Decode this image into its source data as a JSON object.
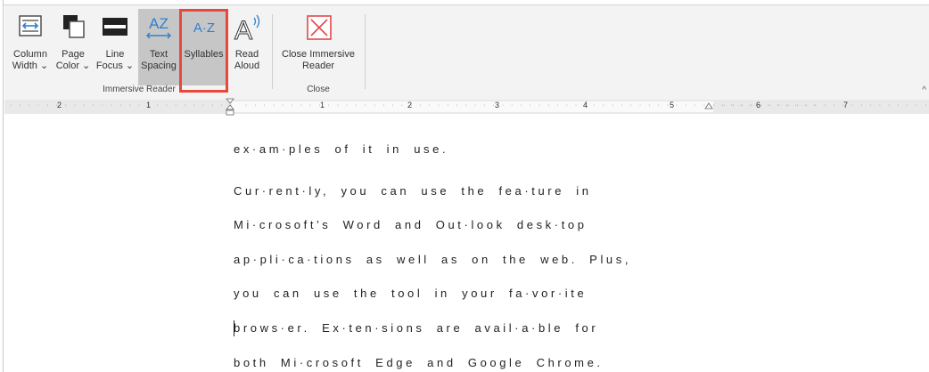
{
  "ribbon": {
    "buttons": [
      {
        "id": "column-width",
        "line1": "Column",
        "line2": "Width ⌄"
      },
      {
        "id": "page-color",
        "line1": "Page",
        "line2": "Color ⌄"
      },
      {
        "id": "line-focus",
        "line1": "Line",
        "line2": "Focus ⌄"
      },
      {
        "id": "text-spacing",
        "line1": "Text",
        "line2": "Spacing"
      },
      {
        "id": "syllables",
        "line1": "Syllables",
        "line2": ""
      },
      {
        "id": "read-aloud",
        "line1": "Read",
        "line2": "Aloud"
      },
      {
        "id": "close-immersive",
        "line1": "Close Immersive",
        "line2": "Reader"
      }
    ],
    "icon_text": {
      "text_spacing": "AZ",
      "syllables": "A·Z",
      "read_aloud": "A"
    },
    "groups": {
      "immersive_reader": "Immersive Reader",
      "close": "Close"
    },
    "collapse_glyph": "^"
  },
  "ruler": {
    "numbers": [
      "2",
      "1",
      "1",
      "2",
      "3",
      "4",
      "5",
      "6",
      "7"
    ]
  },
  "document": {
    "lines": [
      "ex·am·ples of it in use.",
      "Cur·rent·ly, you can use the fea·ture in",
      "Mi·crosoft’s Word and Out·look desk·top",
      "ap·pli·ca·tions as well as on the web. Plus,",
      "you can use the tool in your fa·vor·ite",
      "brows·er. Ex·ten·sions are avail·a·ble for",
      "both Mi·crosoft Edge and Google Chrome."
    ]
  },
  "colors": {
    "ribbon_bg": "#f3f3f3",
    "selected_bg": "#c6c6c6",
    "highlight_box": "#e8483c",
    "icon_blue": "#2f7fd0",
    "close_icon_red": "#e04a4a",
    "ruler_bg": "#e9e9e9"
  }
}
